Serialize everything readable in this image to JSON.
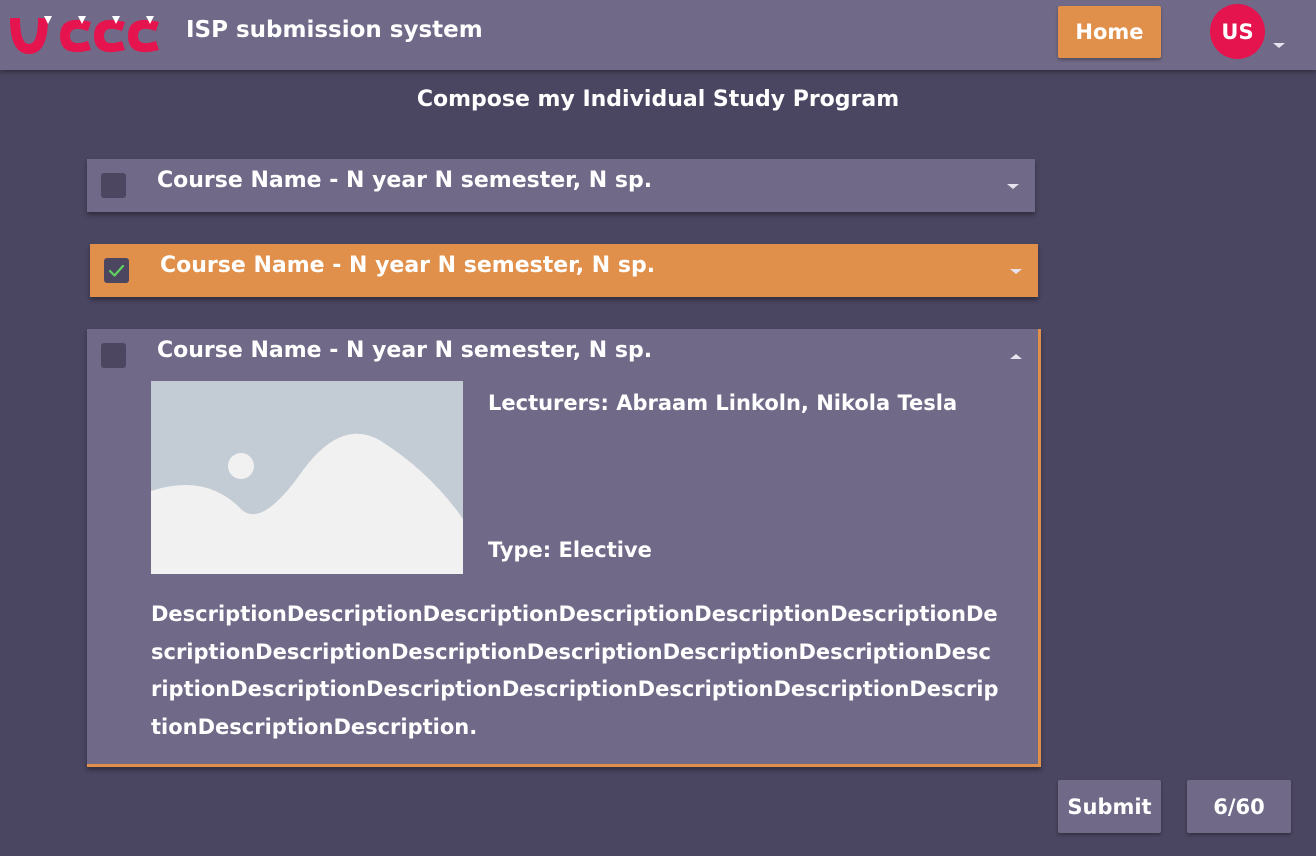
{
  "header": {
    "logo_text": "UCLL",
    "app_title": "ISP submission system",
    "home_label": "Home",
    "user_initials": "US"
  },
  "page": {
    "heading": "Compose my Individual Study Program"
  },
  "courses": [
    {
      "title": "Course Name - N year N semester, N sp.",
      "checked": false,
      "expanded": false
    },
    {
      "title": "Course Name - N year N semester, N sp.",
      "checked": true,
      "expanded": false
    },
    {
      "title": "Course Name - N year N semester, N sp.",
      "checked": false,
      "expanded": true,
      "lecturers": "Lecturers: Abraam Linkoln, Nikola Tesla",
      "type": "Type: Elective",
      "description": "DescriptionDescriptionDescriptionDescriptionDescriptionDescriptionDescriptionDescriptionDescriptionDescriptionDescriptionDescriptionDescriptionDescriptionDescriptionDescriptionDescriptionDescriptionDescriptionDescriptionDescription."
    }
  ],
  "footer": {
    "submit_label": "Submit",
    "credits": "6/60"
  },
  "colors": {
    "background": "#4a4560",
    "panel": "#706a88",
    "accent": "#e0904a",
    "avatar": "#e5134e",
    "checkbox": "#4c4660"
  },
  "icons": {
    "checkmark": "check-icon",
    "expand": "chevron-down-icon",
    "collapse": "chevron-up-icon",
    "image_placeholder": "image-placeholder-icon"
  }
}
